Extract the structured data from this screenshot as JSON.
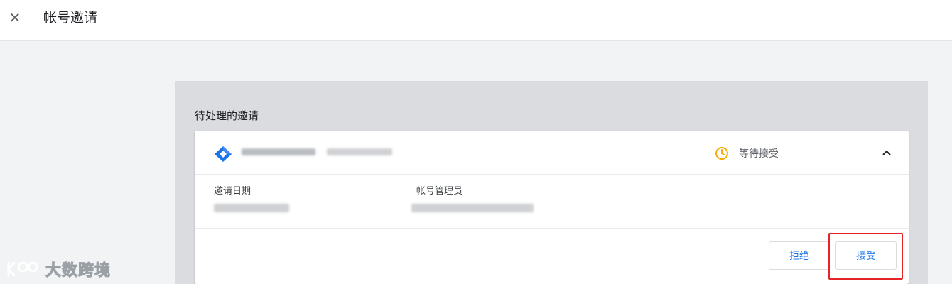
{
  "header": {
    "close_icon": "close-icon",
    "title": "帐号邀请"
  },
  "pending": {
    "section_title": "待处理的邀请",
    "invitation": {
      "product_icon": "gtm-diamond-icon",
      "product_icon_color": "#1a73e8",
      "status_icon": "clock-icon",
      "status_color": "#f9ab00",
      "status": "等待接受",
      "expand_icon": "chevron-up-icon",
      "date_label": "邀请日期",
      "admin_label": "帐号管理员"
    },
    "actions": {
      "reject_label": "拒绝",
      "accept_label": "接受"
    }
  },
  "watermark": {
    "text": "大数跨境"
  },
  "colors": {
    "accent": "#1a73e8",
    "highlight_box": "#e52525",
    "panel_bg": "#dadce0"
  }
}
